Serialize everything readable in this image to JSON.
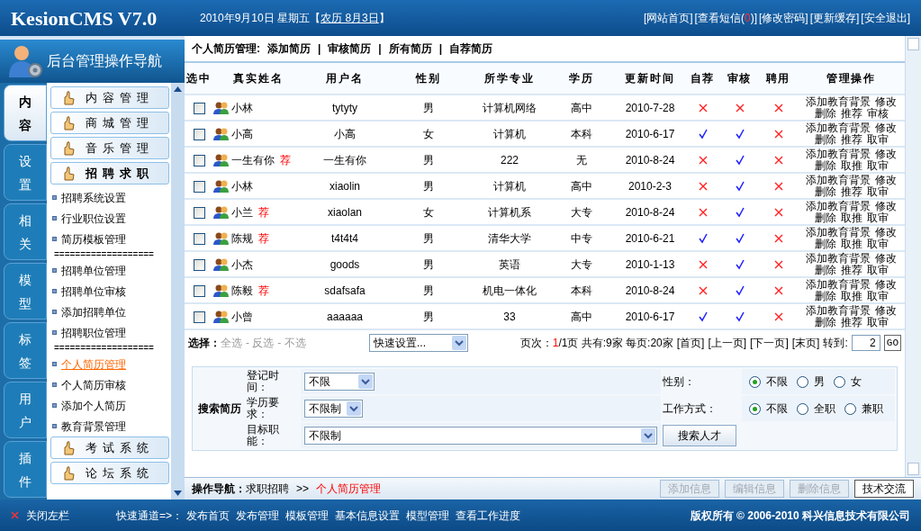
{
  "header": {
    "logo": "KesionCMS V7.0",
    "date": "2010年9月10日 星期五【",
    "lunar": "农历 8月3日",
    "date_end": "】",
    "links": [
      {
        "text": "[网站首页]"
      },
      {
        "text": "[查看短信(",
        "count": "0",
        "after": ")]"
      },
      {
        "text": "[修改密码]"
      },
      {
        "text": "[更新缓存]"
      },
      {
        "text": "[安全退出]"
      }
    ]
  },
  "sidebar": {
    "title": "后台管理操作导航",
    "tabs": [
      {
        "label": "内容",
        "selected": true
      },
      {
        "label": "设置",
        "selected": false
      },
      {
        "label": "相关",
        "selected": false
      },
      {
        "label": "模型",
        "selected": false
      },
      {
        "label": "标签",
        "selected": false
      },
      {
        "label": "用户",
        "selected": false
      },
      {
        "label": "插件",
        "selected": false
      }
    ],
    "menu": [
      {
        "label": "内容管理",
        "expanded": false
      },
      {
        "label": "商城管理",
        "expanded": false
      },
      {
        "label": "音乐管理",
        "expanded": false
      },
      {
        "label": "招聘求职",
        "expanded": true,
        "children": [
          {
            "kind": "link",
            "label": "招聘系统设置",
            "selected": false
          },
          {
            "kind": "link",
            "label": "行业职位设置",
            "selected": false
          },
          {
            "kind": "link",
            "label": "简历模板管理",
            "selected": false
          },
          {
            "kind": "divider",
            "label": "==================="
          },
          {
            "kind": "link",
            "label": "招聘单位管理",
            "selected": false
          },
          {
            "kind": "link",
            "label": "招聘单位审核",
            "selected": false
          },
          {
            "kind": "link",
            "label": "添加招聘单位",
            "selected": false
          },
          {
            "kind": "link",
            "label": "招聘职位管理",
            "selected": false
          },
          {
            "kind": "divider",
            "label": "==================="
          },
          {
            "kind": "link",
            "label": "个人简历管理",
            "selected": true
          },
          {
            "kind": "link",
            "label": "个人简历审核",
            "selected": false
          },
          {
            "kind": "link",
            "label": "添加个人简历",
            "selected": false
          },
          {
            "kind": "link",
            "label": "教育背景管理",
            "selected": false
          }
        ]
      },
      {
        "label": "考试系统",
        "expanded": false
      },
      {
        "label": "论坛系统",
        "expanded": false
      }
    ]
  },
  "breadcrumb": {
    "title": "个人简历管理:",
    "links": [
      "添加简历",
      "审核简历",
      "所有简历",
      "自荐简历"
    ],
    "separator": "|"
  },
  "table": {
    "columns": [
      "选中",
      "真实姓名",
      "用户名",
      "性别",
      "所学专业",
      "学历",
      "更新时间",
      "自荐",
      "审核",
      "聘用",
      "管理操作"
    ],
    "rows": [
      {
        "checked": false,
        "name": "小林",
        "username": "tytyty",
        "gender": "男",
        "major": "计算机网络",
        "education": "高中",
        "updated": "2010-7-28",
        "recommended": false,
        "audited": false,
        "hired": false,
        "actions": [
          "添加教育背景",
          "修改",
          "删除",
          "推荐",
          "审核"
        ]
      },
      {
        "checked": false,
        "name": "小高",
        "username": "小高",
        "gender": "女",
        "major": "计算机",
        "education": "本科",
        "updated": "2010-6-17",
        "recommended": true,
        "audited": true,
        "hired": false,
        "actions": [
          "添加教育背景",
          "修改",
          "删除",
          "推荐",
          "取审"
        ]
      },
      {
        "checked": false,
        "name": "一生有你",
        "tag": "荐",
        "username": "一生有你",
        "gender": "男",
        "major": "222",
        "education": "无",
        "updated": "2010-8-24",
        "recommended": false,
        "audited": true,
        "hired": false,
        "actions": [
          "添加教育背景",
          "修改",
          "删除",
          "取推",
          "取审"
        ]
      },
      {
        "checked": false,
        "name": "小林",
        "username": "xiaolin",
        "gender": "男",
        "major": "计算机",
        "education": "高中",
        "updated": "2010-2-3",
        "recommended": false,
        "audited": true,
        "hired": false,
        "actions": [
          "添加教育背景",
          "修改",
          "删除",
          "推荐",
          "取审"
        ]
      },
      {
        "checked": false,
        "name": "小兰",
        "tag": "荐",
        "username": "xiaolan",
        "gender": "女",
        "major": "计算机系",
        "education": "大专",
        "updated": "2010-8-24",
        "recommended": false,
        "audited": true,
        "hired": false,
        "actions": [
          "添加教育背景",
          "修改",
          "删除",
          "取推",
          "取审"
        ]
      },
      {
        "checked": false,
        "name": "陈规",
        "tag": "荐",
        "username": "t4t4t4",
        "gender": "男",
        "major": "清华大学",
        "education": "中专",
        "updated": "2010-6-21",
        "recommended": true,
        "audited": true,
        "hired": false,
        "actions": [
          "添加教育背景",
          "修改",
          "删除",
          "取推",
          "取审"
        ]
      },
      {
        "checked": false,
        "name": "小杰",
        "username": "goods",
        "gender": "男",
        "major": "英语",
        "education": "大专",
        "updated": "2010-1-13",
        "recommended": false,
        "audited": true,
        "hired": false,
        "actions": [
          "添加教育背景",
          "修改",
          "删除",
          "推荐",
          "取审"
        ]
      },
      {
        "checked": false,
        "name": "陈毅",
        "tag": "荐",
        "username": "sdafsafa",
        "gender": "男",
        "major": "机电一体化",
        "education": "本科",
        "updated": "2010-8-24",
        "recommended": false,
        "audited": true,
        "hired": false,
        "actions": [
          "添加教育背景",
          "修改",
          "删除",
          "取推",
          "取审"
        ]
      },
      {
        "checked": false,
        "name": "小曾",
        "username": "aaaaaa",
        "gender": "男",
        "major": "33",
        "education": "高中",
        "updated": "2010-6-17",
        "recommended": true,
        "audited": true,
        "hired": false,
        "actions": [
          "添加教育背景",
          "修改",
          "删除",
          "推荐",
          "取审"
        ]
      }
    ]
  },
  "selection": {
    "label": "选择：",
    "links": [
      "全选",
      "- 反选",
      "- 不选"
    ],
    "quick_setting": "快速设置..."
  },
  "pagination": {
    "label": "页次：",
    "current": "1",
    "summary": "/1页 共有:9家 每页:20家",
    "links": [
      "[首页]",
      "[上一页]",
      "[下一页]",
      "[末页]"
    ],
    "goto_label": "转到:",
    "goto_value": "2",
    "go": "GO"
  },
  "search": {
    "title": "搜索简历",
    "fields": [
      {
        "label": "登记时间：",
        "value": "不限"
      },
      {
        "label": "学历要求：",
        "value": "不限制"
      },
      {
        "label": "目标职能：",
        "value": "不限制",
        "button": "搜索人才"
      }
    ],
    "radio_groups": [
      {
        "label": "性别：",
        "options": [
          {
            "label": "不限",
            "selected": true
          },
          {
            "label": "男",
            "selected": false
          },
          {
            "label": "女",
            "selected": false
          }
        ]
      },
      {
        "label": "工作方式：",
        "options": [
          {
            "label": "不限",
            "selected": true
          },
          {
            "label": "全职",
            "selected": false
          },
          {
            "label": "兼职",
            "selected": false
          }
        ]
      }
    ]
  },
  "operation_bar": {
    "label": "操作导航：",
    "path": "求职招聘",
    "arrow": ">>",
    "current": "个人简历管理",
    "buttons": [
      {
        "label": "添加信息",
        "disabled": true
      },
      {
        "label": "编辑信息",
        "disabled": true
      },
      {
        "label": "删除信息",
        "disabled": true
      },
      {
        "label": "技术交流",
        "disabled": false
      }
    ]
  },
  "footer": {
    "close": "关闭左栏",
    "quick_label": "快速通道=>：",
    "links": [
      "发布首页",
      "发布管理",
      "模板管理",
      "基本信息设置",
      "模型管理",
      "查看工作进度"
    ],
    "copyright": "版权所有 © 2006-2010 科兴信息技术有限公司"
  }
}
